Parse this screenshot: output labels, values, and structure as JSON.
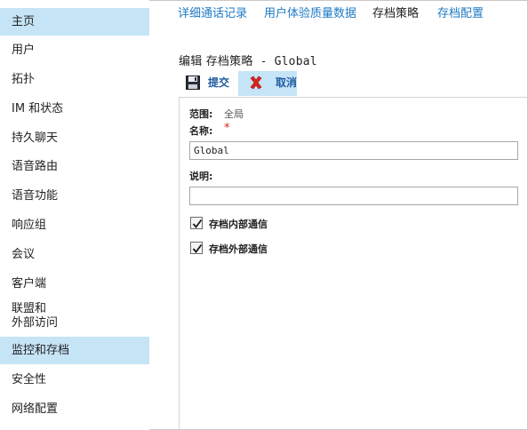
{
  "sidebar": {
    "items": [
      {
        "label": "主页"
      },
      {
        "label": "用户"
      },
      {
        "label": "拓扑"
      },
      {
        "label": "IM 和状态"
      },
      {
        "label": "持久聊天"
      },
      {
        "label": "语音路由"
      },
      {
        "label": "语音功能"
      },
      {
        "label": "响应组"
      },
      {
        "label": "会议"
      },
      {
        "label": "客户端"
      },
      {
        "label_line1": "联盟和",
        "label_line2": "外部访问"
      },
      {
        "label": "监控和存档"
      },
      {
        "label": "安全性"
      },
      {
        "label": "网络配置"
      }
    ]
  },
  "tabs": [
    {
      "label": "详细通话记录"
    },
    {
      "label": "用户体验质量数据"
    },
    {
      "label": "存档策略"
    },
    {
      "label": "存档配置"
    }
  ],
  "page": {
    "title_prefix": "编辑 存档策略",
    "title_suffix": " - Global"
  },
  "toolbar": {
    "save_label": "提交",
    "cancel_label": "取消"
  },
  "form": {
    "scope_label": "范围:",
    "scope_value": "全局",
    "name_label": "名称:",
    "name_required": "*",
    "name_value": "Global",
    "description_label": "说明:",
    "description_value": "",
    "archive_internal_label": "存档内部通信",
    "archive_internal_checked": true,
    "archive_external_label": "存档外部通信",
    "archive_external_checked": true
  },
  "colors": {
    "active_bg": "#c5e4f6",
    "link": "#1e7ac4",
    "required": "#d9261c"
  }
}
